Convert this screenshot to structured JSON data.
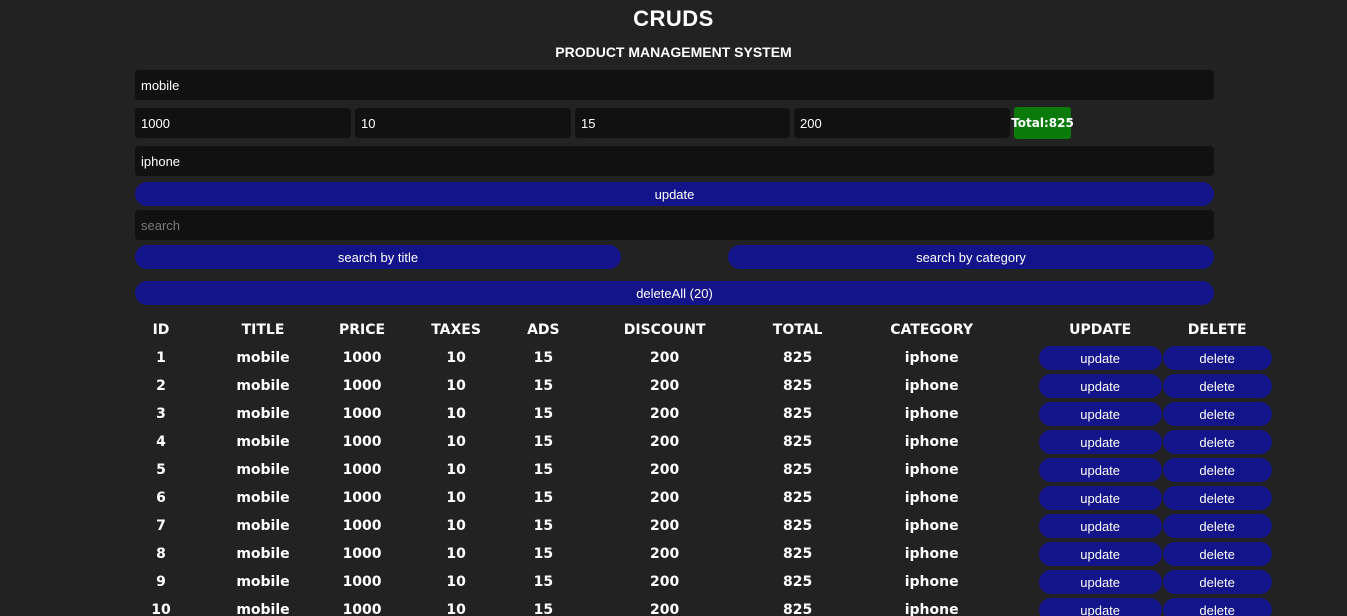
{
  "header": {
    "title": "CRUDS",
    "subtitle": "PRODUCT MANAGEMENT SYSTEM"
  },
  "form": {
    "title_value": "mobile",
    "price_value": "1000",
    "taxes_value": "10",
    "ads_value": "15",
    "discount_value": "200",
    "total_label": "Total:825",
    "category_value": "iphone",
    "submit_label": "update"
  },
  "search": {
    "placeholder": "search",
    "by_title_label": "search by title",
    "by_category_label": "search by category"
  },
  "delete_all_label": "deleteAll (20)",
  "table": {
    "headers": [
      "ID",
      "TITLE",
      "PRICE",
      "TAXES",
      "ADS",
      "DISCOUNT",
      "TOTAL",
      "CATEGORY",
      "UPDATE",
      "DELETE"
    ],
    "update_label": "update",
    "delete_label": "delete",
    "rows": [
      {
        "id": "1",
        "title": "mobile",
        "price": "1000",
        "taxes": "10",
        "ads": "15",
        "discount": "200",
        "total": "825",
        "category": "iphone"
      },
      {
        "id": "2",
        "title": "mobile",
        "price": "1000",
        "taxes": "10",
        "ads": "15",
        "discount": "200",
        "total": "825",
        "category": "iphone"
      },
      {
        "id": "3",
        "title": "mobile",
        "price": "1000",
        "taxes": "10",
        "ads": "15",
        "discount": "200",
        "total": "825",
        "category": "iphone"
      },
      {
        "id": "4",
        "title": "mobile",
        "price": "1000",
        "taxes": "10",
        "ads": "15",
        "discount": "200",
        "total": "825",
        "category": "iphone"
      },
      {
        "id": "5",
        "title": "mobile",
        "price": "1000",
        "taxes": "10",
        "ads": "15",
        "discount": "200",
        "total": "825",
        "category": "iphone"
      },
      {
        "id": "6",
        "title": "mobile",
        "price": "1000",
        "taxes": "10",
        "ads": "15",
        "discount": "200",
        "total": "825",
        "category": "iphone"
      },
      {
        "id": "7",
        "title": "mobile",
        "price": "1000",
        "taxes": "10",
        "ads": "15",
        "discount": "200",
        "total": "825",
        "category": "iphone"
      },
      {
        "id": "8",
        "title": "mobile",
        "price": "1000",
        "taxes": "10",
        "ads": "15",
        "discount": "200",
        "total": "825",
        "category": "iphone"
      },
      {
        "id": "9",
        "title": "mobile",
        "price": "1000",
        "taxes": "10",
        "ads": "15",
        "discount": "200",
        "total": "825",
        "category": "iphone"
      },
      {
        "id": "10",
        "title": "mobile",
        "price": "1000",
        "taxes": "10",
        "ads": "15",
        "discount": "200",
        "total": "825",
        "category": "iphone"
      }
    ]
  },
  "colors": {
    "background": "#222222",
    "input_background": "#111111",
    "button_background": "#13138a",
    "total_background": "#0a7a0a",
    "text": "#ffffff"
  }
}
